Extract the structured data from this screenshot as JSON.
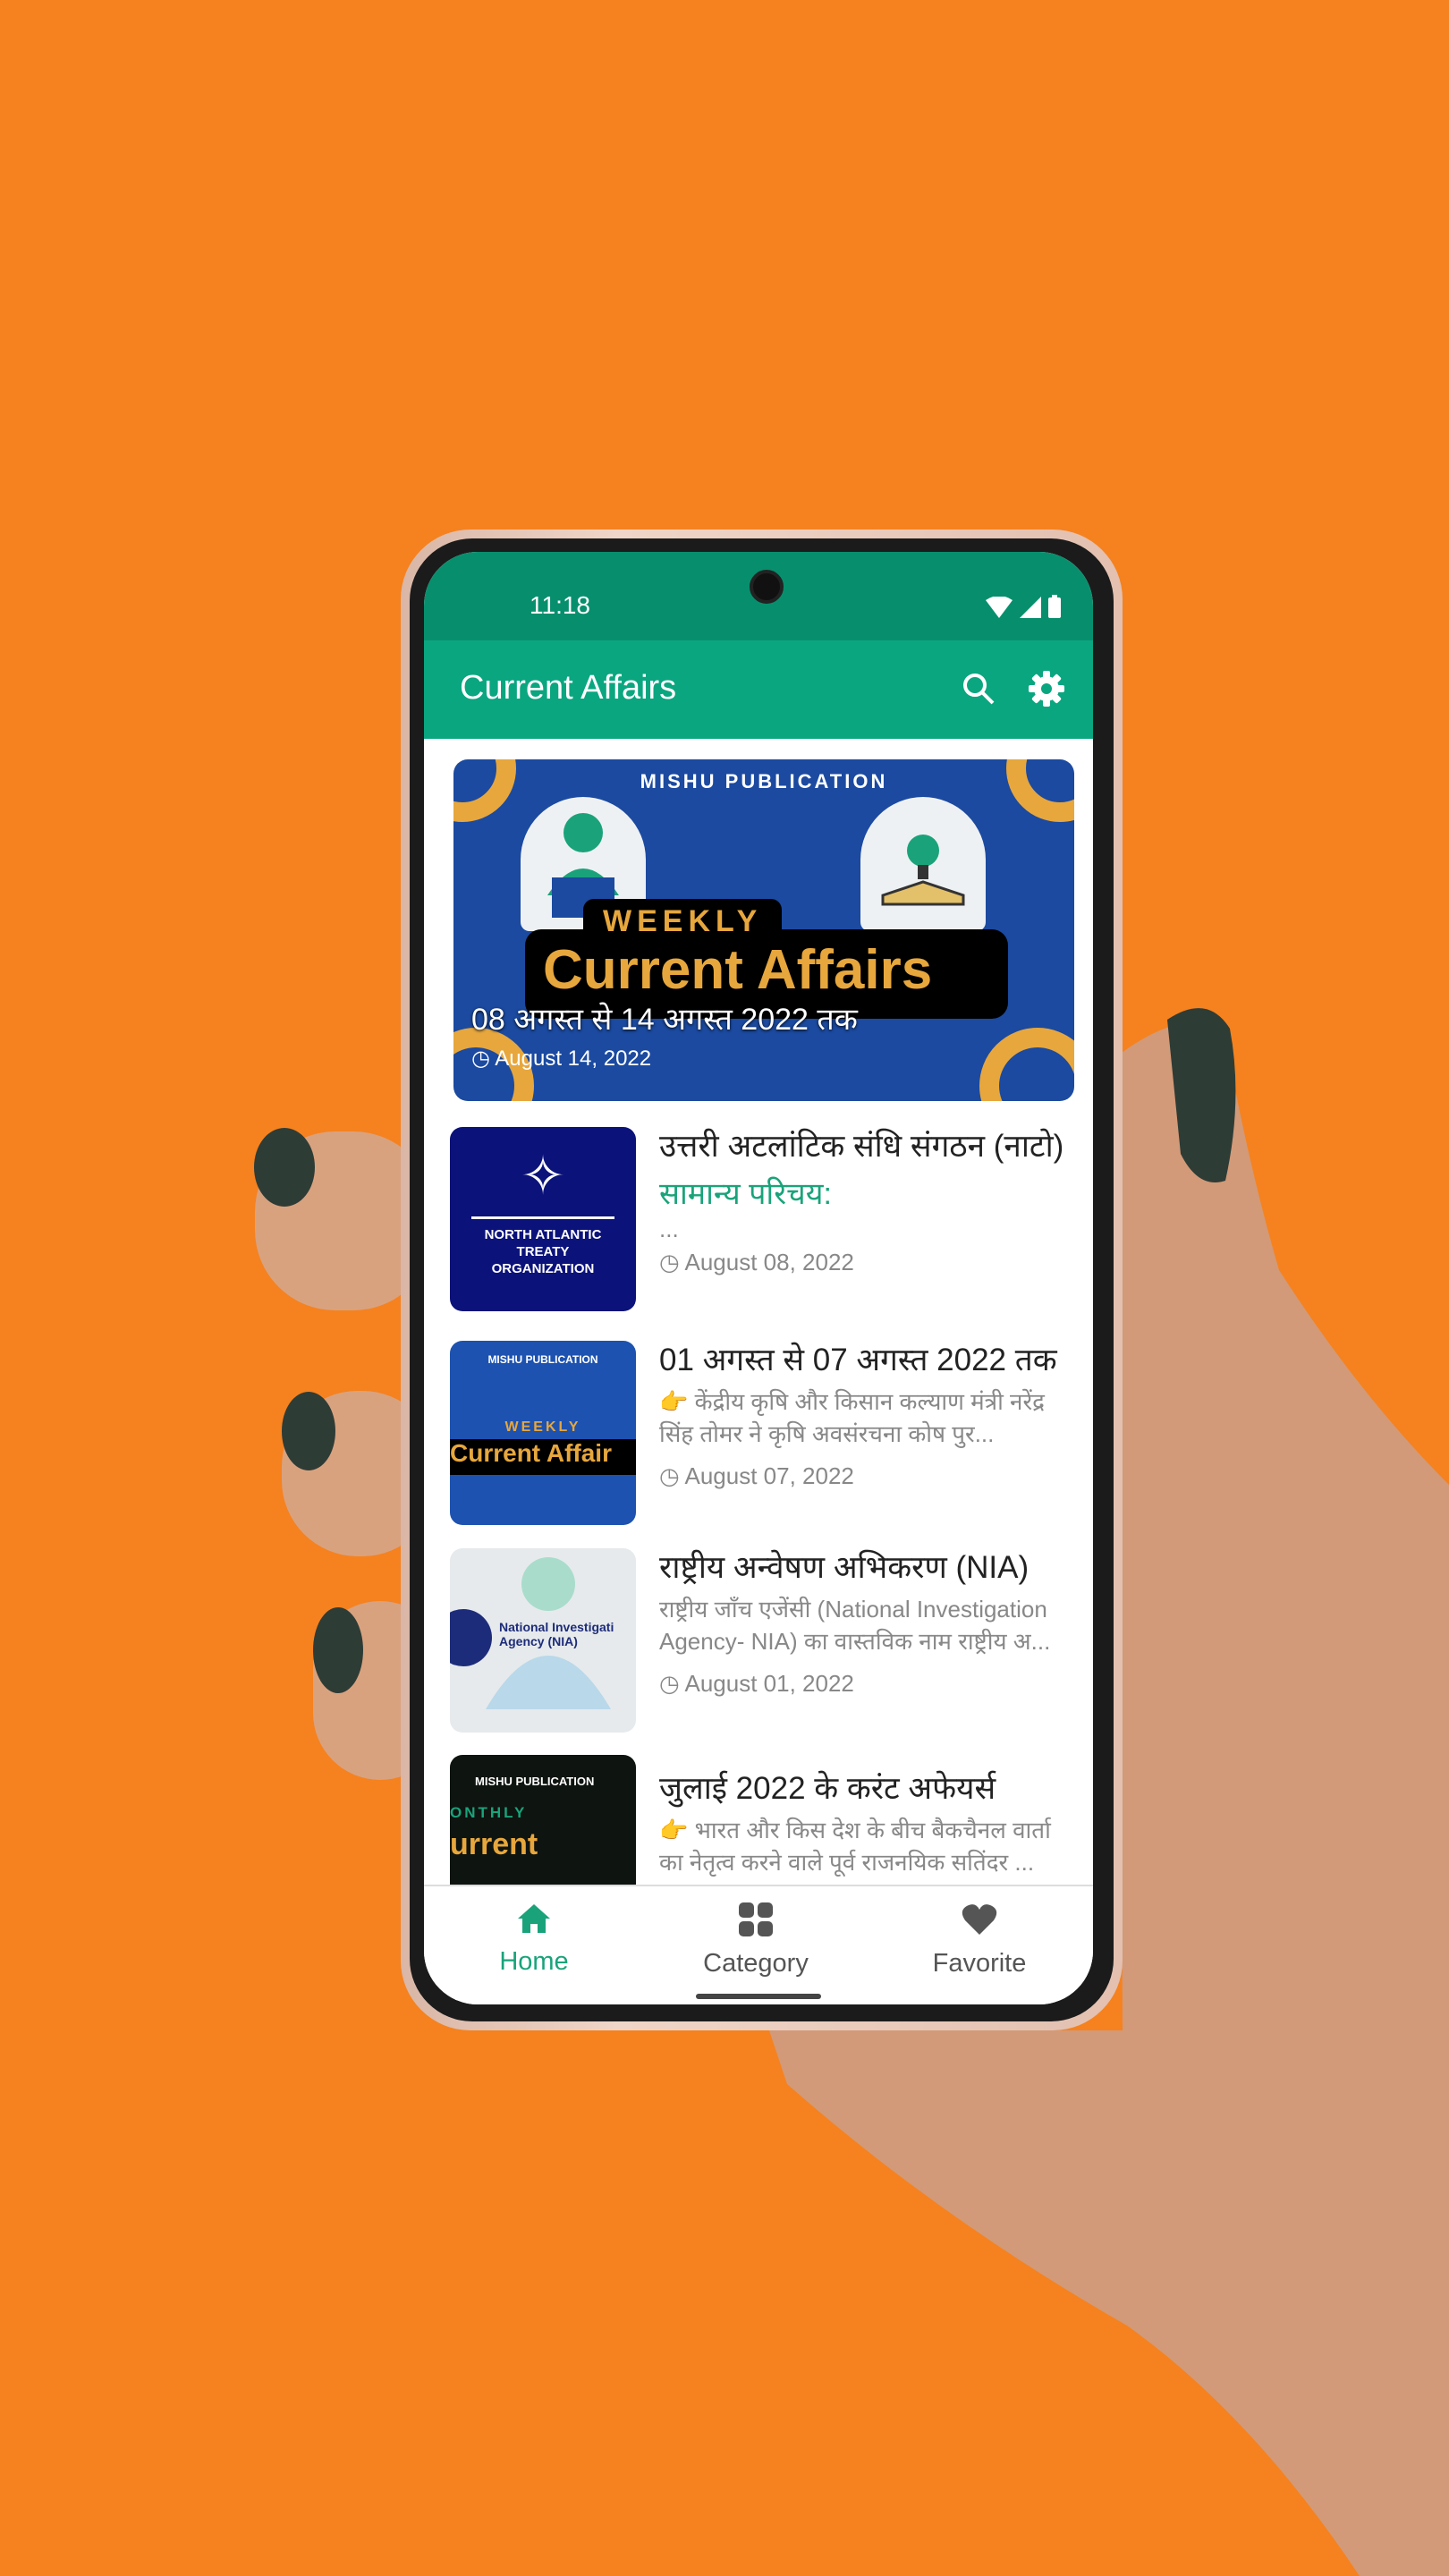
{
  "status_bar": {
    "time": "11:18"
  },
  "app_bar": {
    "title": "Current Affairs",
    "icons": [
      "search-icon",
      "gear-icon"
    ]
  },
  "colors": {
    "background": "#F5821F",
    "status_bar": "#078F6D",
    "app_bar": "#0AA680",
    "accent": "#1AA37A"
  },
  "featured": {
    "image": {
      "publisher": "MISHU PUBLICATION",
      "weekly": "WEEKLY",
      "heading": "Current Affairs"
    },
    "title": "08 अगस्त से 14 अगस्त 2022 तक",
    "date": "August 14, 2022"
  },
  "articles": [
    {
      "title": "उत्तरी अटलांटिक संधि संगठन (नाटो)",
      "subtitle": "सामान्य परिचय:",
      "excerpt": "...",
      "date": "August 08, 2022",
      "thumb_text": "NORTH ATLANTIC TREATY ORGANIZATION"
    },
    {
      "title": "01 अगस्त से 07 अगस्त 2022 तक",
      "excerpt": "👉 केंद्रीय कृषि और किसान कल्याण मंत्री नरेंद्र सिंह तोमर ने कृषि अवसंरचना कोष पुर...",
      "date": "August 07, 2022",
      "thumb_pub": "MISHU PUBLICATION",
      "thumb_weekly": "WEEKLY",
      "thumb_heading": "Current Affair"
    },
    {
      "title": "राष्ट्रीय अन्वेषण अभिकरण (NIA)",
      "excerpt": "राष्ट्रीय जाँच एजेंसी (National Investigation Agency- NIA) का वास्तविक नाम राष्ट्रीय अ...",
      "date": "August 01, 2022",
      "thumb_text": "National Investigati Agency (NIA)"
    },
    {
      "title": "जुलाई 2022 के करंट अफेयर्स",
      "excerpt": "👉 भारत और किस देश के बीच बैकचैनल वार्ता का नेतृत्व करने वाले पूर्व राजनयिक सतिंदर ...",
      "thumb_pub": "MISHU PUBLICATION",
      "thumb_monthly": "ONTHLY",
      "thumb_heading": "urrent"
    }
  ],
  "bottom_nav": {
    "active": "Home",
    "items": [
      {
        "label": "Home",
        "icon": "home-icon"
      },
      {
        "label": "Category",
        "icon": "grid-icon"
      },
      {
        "label": "Favorite",
        "icon": "heart-icon"
      }
    ]
  }
}
